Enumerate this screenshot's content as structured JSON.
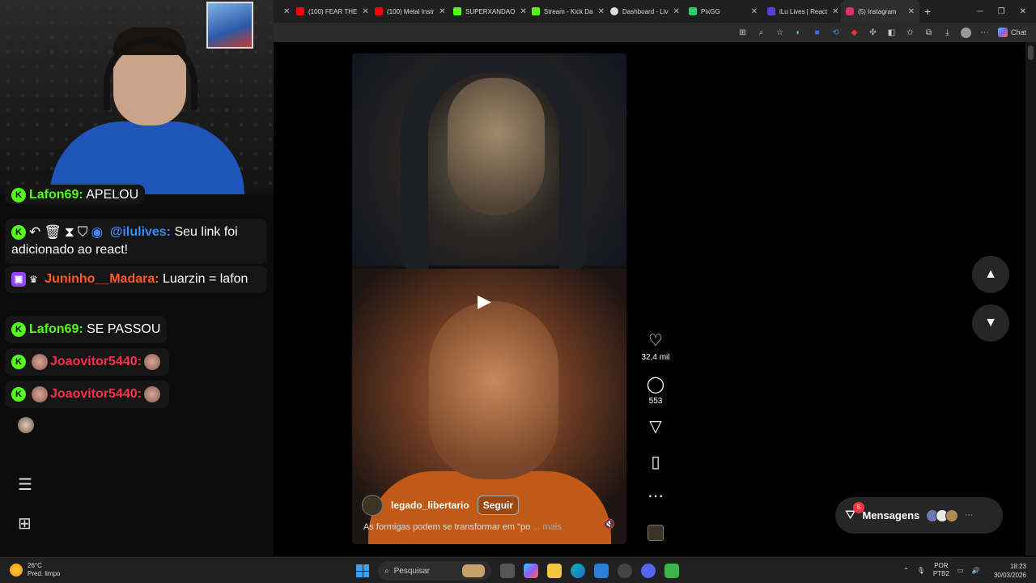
{
  "browser": {
    "tabs": [
      {
        "label": "(100) FEAR THE",
        "color": "#ff0000"
      },
      {
        "label": "(100) Metal Instr",
        "color": "#ff0000"
      },
      {
        "label": "SUPERXANDAO",
        "color": "#53fc18"
      },
      {
        "label": "Stream - Kick Da",
        "color": "#53fc18"
      },
      {
        "label": "Dashboard - Liv",
        "color": "#dddddd"
      },
      {
        "label": "PixGG",
        "color": "#2ecc71"
      },
      {
        "label": "iLu Lives | React",
        "color": "#5b3fd6"
      },
      {
        "label": "(5) Instagram",
        "color": "#e1306c"
      }
    ],
    "chat_button_label": "Chat"
  },
  "chat": {
    "messages": [
      {
        "user": "Lafon69:",
        "text": "APELOU"
      },
      {
        "user": "@ilulives:",
        "text": "Seu link foi adicionado ao react!"
      },
      {
        "user": "Juninho__Madara:",
        "text": "Luarzin = lafon"
      },
      {
        "user": "Lafon69:",
        "text": "SE PASSOU"
      },
      {
        "user": "Joaovitor5440:",
        "text": ""
      },
      {
        "user": "Joaovitor5440:",
        "text": ""
      }
    ]
  },
  "reel": {
    "username": "legado_libertario",
    "follow_label": "Seguir",
    "caption": "As formigas podem se transformar em \"po",
    "more_label": "... mais"
  },
  "actions": {
    "likes": "32,4 mil",
    "comments": "553"
  },
  "messages_pill": {
    "label": "Mensagens",
    "unread": "5"
  },
  "taskbar": {
    "temperature": "26°C",
    "weather_desc": "Pred. limpo",
    "search_placeholder": "Pesquisar",
    "lang_line1": "POR",
    "lang_line2": "PTB2",
    "time": "18:23",
    "date": "30/03/2026"
  }
}
